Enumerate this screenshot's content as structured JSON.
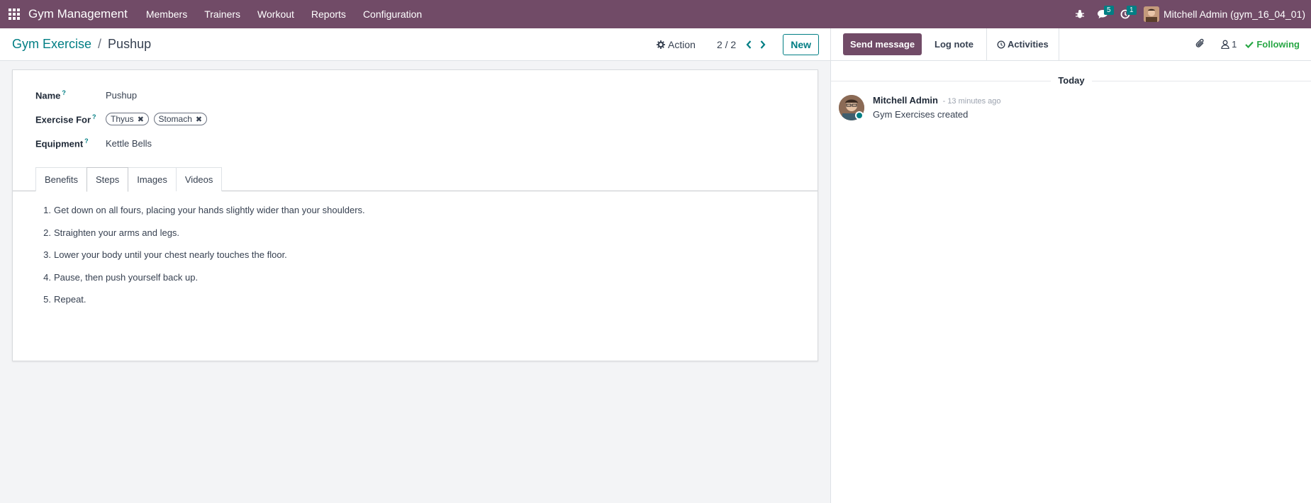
{
  "navbar": {
    "brand": "Gym Management",
    "menu": [
      "Members",
      "Trainers",
      "Workout",
      "Reports",
      "Configuration"
    ],
    "messages_badge": "5",
    "activities_badge": "1",
    "user": "Mitchell Admin (gym_16_04_01)"
  },
  "control_panel": {
    "breadcrumb_parent": "Gym Exercise",
    "breadcrumb_separator": "/",
    "breadcrumb_current": "Pushup",
    "action_label": "Action",
    "pager": "2 / 2",
    "new_label": "New"
  },
  "form": {
    "name_label": "Name",
    "name_value": "Pushup",
    "exercise_for_label": "Exercise For",
    "exercise_for_tags": [
      "Thyus",
      "Stomach"
    ],
    "equipment_label": "Equipment",
    "equipment_value": "Kettle Bells",
    "help_mark": "?",
    "tabs": [
      "Benefits",
      "Steps",
      "Images",
      "Videos"
    ],
    "active_tab": "Steps",
    "steps": [
      "Get down on all fours, placing your hands slightly wider than your shoulders.",
      "Straighten your arms and legs.",
      "Lower your body until your chest nearly touches the floor.",
      "Pause, then push yourself back up.",
      "Repeat."
    ]
  },
  "chatter": {
    "send_message": "Send message",
    "log_note": "Log note",
    "activities": "Activities",
    "followers_count": "1",
    "following": "Following",
    "date_separator": "Today",
    "message": {
      "author": "Mitchell Admin",
      "time": "- 13 minutes ago",
      "body": "Gym Exercises created"
    }
  },
  "colors": {
    "brand": "#714b67",
    "accent": "#017e84",
    "following": "#28a745"
  }
}
